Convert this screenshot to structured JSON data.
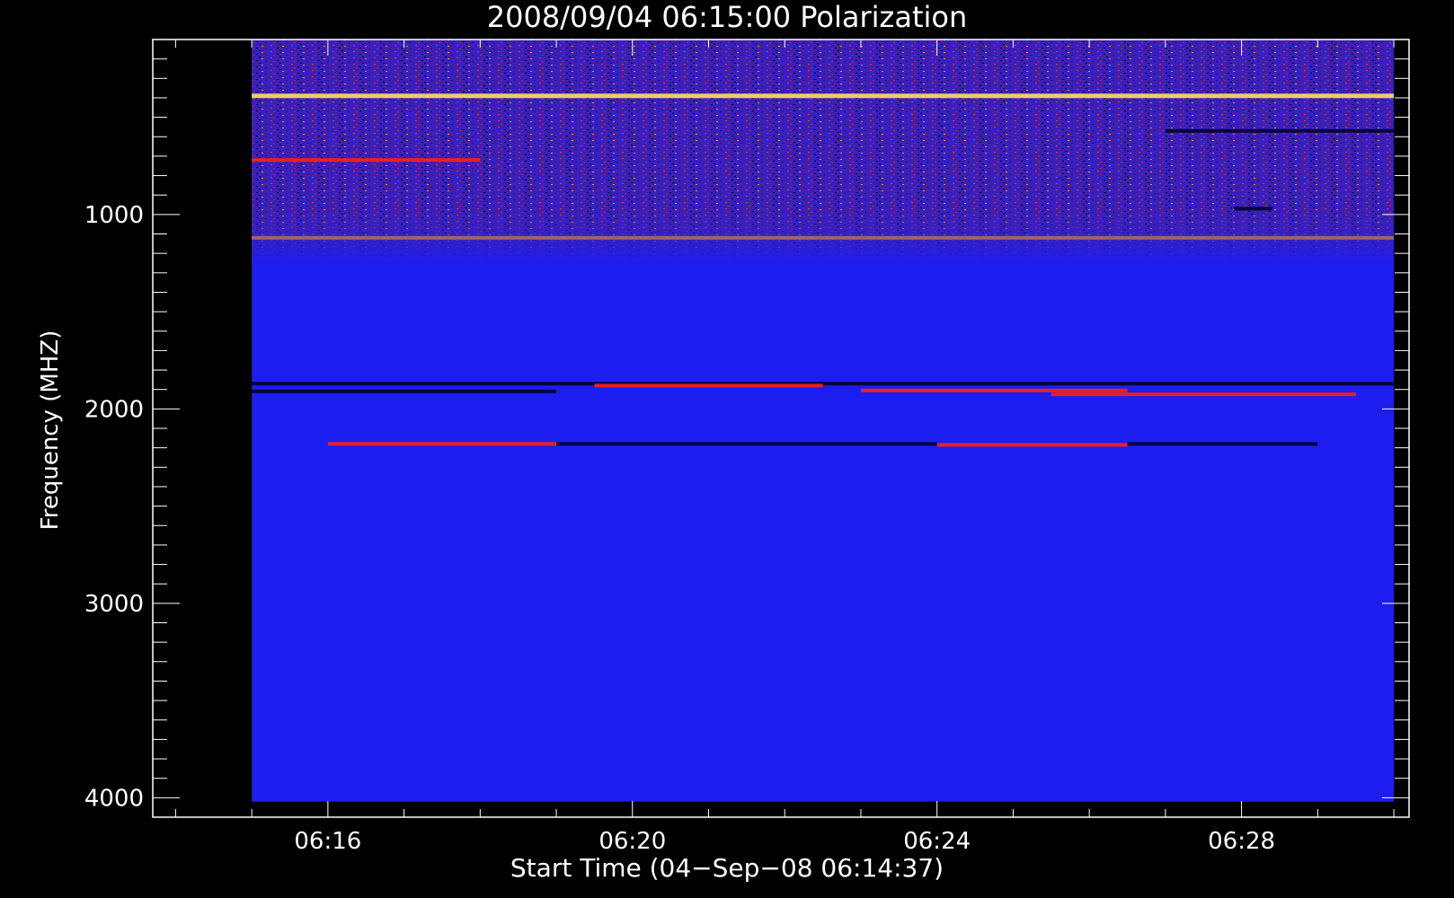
{
  "chart_data": {
    "type": "heatmap",
    "title": "2008/09/04 06:15:00 Polarization",
    "xlabel": "Start Time (04−Sep−08 06:14:37)",
    "ylabel": "Frequency (MHZ)",
    "x_ticks": [
      {
        "label": "06:16",
        "minutes": 16
      },
      {
        "label": "06:20",
        "minutes": 20
      },
      {
        "label": "06:24",
        "minutes": 24
      },
      {
        "label": "06:28",
        "minutes": 28
      }
    ],
    "x_range_minutes": [
      13.7,
      30.2
    ],
    "data_x_range_minutes": [
      15.0,
      30.0
    ],
    "y_ticks": [
      {
        "label": "1000",
        "value": 1000
      },
      {
        "label": "2000",
        "value": 2000
      },
      {
        "label": "3000",
        "value": 3000
      },
      {
        "label": "4000",
        "value": 4000
      }
    ],
    "y_range": [
      100,
      4100
    ],
    "y_inverted": true,
    "data_y_range": [
      100,
      4020
    ],
    "colors": {
      "background": "#000000",
      "axes": "#ffffff",
      "field": "#1c1ef0",
      "noise_region": "#3a20b8",
      "band_red": "#ff2010",
      "band_dark": "#000030",
      "band_yellow": "#ffe060"
    },
    "features": [
      {
        "kind": "noise-region",
        "freq_range": [
          100,
          1250
        ]
      },
      {
        "kind": "band",
        "color": "yellow",
        "freq": 390,
        "t_range": [
          15.0,
          30.0
        ]
      },
      {
        "kind": "band",
        "color": "dark",
        "freq": 570,
        "t_range": [
          27.0,
          30.0
        ]
      },
      {
        "kind": "band",
        "color": "red",
        "freq": 720,
        "t_range": [
          15.0,
          18.0
        ]
      },
      {
        "kind": "band",
        "color": "dark",
        "freq": 970,
        "t_range": [
          27.9,
          28.4
        ]
      },
      {
        "kind": "band",
        "color": "orange",
        "freq": 1120,
        "t_range": [
          15.0,
          30.0
        ]
      },
      {
        "kind": "band",
        "color": "dark",
        "freq": 1870,
        "t_range": [
          15.0,
          30.0
        ]
      },
      {
        "kind": "band",
        "color": "red",
        "freq": 1880,
        "t_range": [
          19.5,
          22.5
        ]
      },
      {
        "kind": "band",
        "color": "dark",
        "freq": 1910,
        "t_range": [
          15.0,
          19.0
        ]
      },
      {
        "kind": "band",
        "color": "red",
        "freq": 1905,
        "t_range": [
          23.0,
          26.5
        ]
      },
      {
        "kind": "band",
        "color": "red",
        "freq": 1925,
        "t_range": [
          25.5,
          29.5
        ]
      },
      {
        "kind": "band",
        "color": "red",
        "freq": 2180,
        "t_range": [
          16.0,
          19.0
        ]
      },
      {
        "kind": "band",
        "color": "dark",
        "freq": 2180,
        "t_range": [
          19.0,
          24.0
        ]
      },
      {
        "kind": "band",
        "color": "red",
        "freq": 2185,
        "t_range": [
          24.0,
          26.5
        ]
      },
      {
        "kind": "band",
        "color": "dark",
        "freq": 2180,
        "t_range": [
          26.5,
          29.0
        ]
      }
    ]
  }
}
